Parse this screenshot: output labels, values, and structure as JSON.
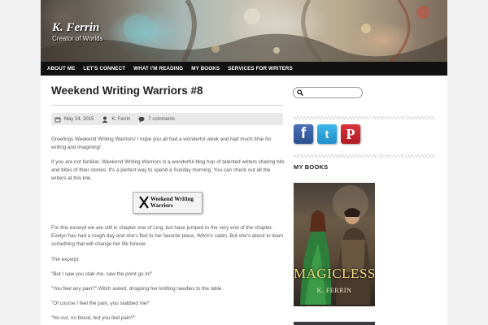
{
  "header": {
    "site_title": "K. Ferrin",
    "tagline": "Creator of Worlds"
  },
  "nav": {
    "items": [
      {
        "label": "ABOUT ME"
      },
      {
        "label": "LET'S CONNECT"
      },
      {
        "label": "WHAT I'M READING"
      },
      {
        "label": "MY BOOKS"
      },
      {
        "label": "SERVICES FOR WRITERS"
      }
    ]
  },
  "post": {
    "title": "Weekend Writing Warriors #8",
    "date": "May 24, 2015",
    "author": "K. Ferrin",
    "comments": "7 comments",
    "paragraphs": [
      "Greetings Weekend Writing Warriors! I hope you all had a wonderful week and had much time for writing and imagining!",
      "If you are not familiar, Weekend Writing Warriors is a wonderful blog hop of talented writers sharing bits and bites of their stories. It's a perfect way to spend a Sunday morning. You can check out all the writers at this link.",
      "For this excerpt we are still in chapter one of Ling, but have jumped to the very end of the chapter. Evelyn has had a rough day and she's fled to her favorite place, Witch's cabin. But she's about to learn something that will change her life forever.",
      "The excerpt:",
      "\"But I saw you stab me, saw the point go in!\"",
      "\"You feel any pain?\" Witch asked, dropping her knitting needles to the table.",
      "\"Of course I feel the pain, you stabbed me!\"",
      "\"No cut, no blood, but you feel pain?\""
    ],
    "badge_text": "Weekend Writing\nWarriors"
  },
  "sidebar": {
    "search_placeholder": "",
    "social": {
      "facebook_glyph": "f",
      "twitter_glyph": "t",
      "pinterest_glyph": "P"
    },
    "books_title": "MY BOOKS",
    "book": {
      "title": "MAGICLESS",
      "author": "K. FERRIN"
    }
  },
  "colors": {
    "navbar": "#111111",
    "facebook": "#3b5998",
    "twitter": "#2aa9e0",
    "pinterest": "#cb2027"
  }
}
